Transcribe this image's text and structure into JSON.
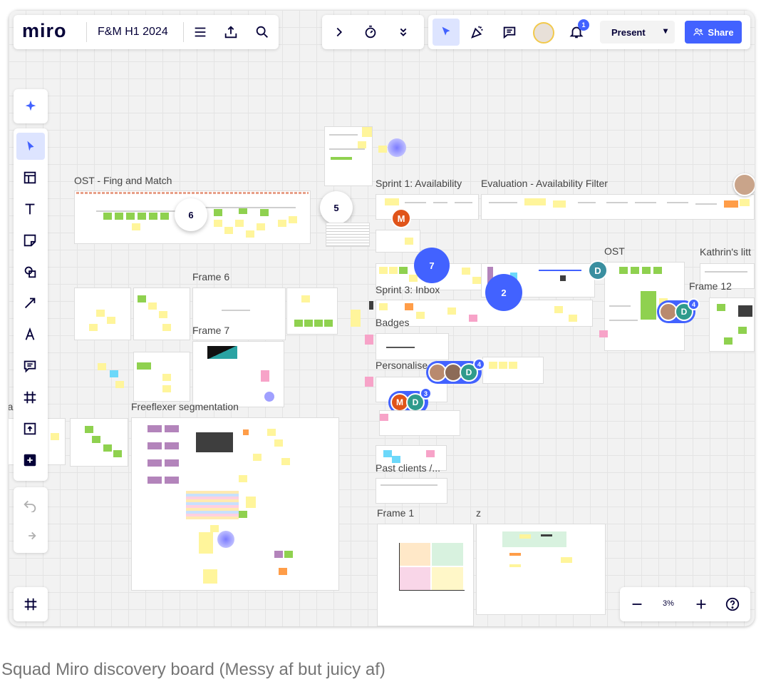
{
  "app": {
    "logo": "miro",
    "board_title": "F&M H1 2024"
  },
  "toolbar_right": {
    "present_label": "Present",
    "share_label": "Share",
    "notification_count": "1",
    "accent_color": "#4262ff"
  },
  "left_toolbar": {
    "tools": [
      "ai-assist-icon",
      "select-icon",
      "templates-icon",
      "text-icon",
      "sticky-note-icon",
      "shapes-icon",
      "connector-icon",
      "pen-icon",
      "comment-icon",
      "frame-icon",
      "upload-icon",
      "add-more-icon"
    ],
    "history": [
      "undo-icon",
      "redo-icon"
    ]
  },
  "zoom": {
    "level": "3%"
  },
  "frames": {
    "ost_fing": "OST - Fing and Match",
    "sprint1": "Sprint 1: Availability",
    "evaluation": "Evaluation - Availability Filter",
    "frame6": "Frame 6",
    "frame7": "Frame 7",
    "sprint3": "Sprint 3: Inbox",
    "ost": "OST",
    "kathrins": "Kathrin's litt",
    "frame12": "Frame 12",
    "badges": "Badges",
    "personalise": "Personalise",
    "freeflexer": "Freeflexer segmentation",
    "past_clients": "Past clients /...",
    "frame1": "Frame 1",
    "z": "z",
    "left_cut": "ra"
  },
  "comment_bubbles": {
    "c6": "6",
    "c5": "5",
    "c7": "7",
    "c2": "2"
  },
  "collaborators": {
    "m_initial": "M",
    "d_initial": "D",
    "group1_count": "4",
    "group2_count": "4",
    "group3_count": "3"
  },
  "caption": "Squad Miro discovery board (Messy af but juicy af)"
}
